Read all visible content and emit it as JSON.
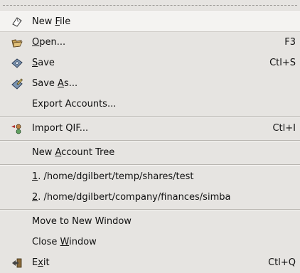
{
  "menu": {
    "items": [
      {
        "pre": "New ",
        "mn": "F",
        "post": "ile",
        "accel": "",
        "icon": "new-file-icon"
      },
      {
        "pre": "",
        "mn": "O",
        "post": "pen...",
        "accel": "F3",
        "icon": "open-folder-icon"
      },
      {
        "pre": "",
        "mn": "S",
        "post": "ave",
        "accel": "Ctl+S",
        "icon": "save-icon"
      },
      {
        "pre": "Save ",
        "mn": "A",
        "post": "s...",
        "accel": "",
        "icon": "save-as-icon"
      },
      {
        "pre": "Export Accounts...",
        "mn": "",
        "post": "",
        "accel": "",
        "icon": ""
      },
      {
        "pre": "Import QIF...",
        "mn": "",
        "post": "",
        "accel": "Ctl+I",
        "icon": "import-icon"
      },
      {
        "pre": "New ",
        "mn": "A",
        "post": "ccount Tree",
        "accel": "",
        "icon": ""
      },
      {
        "pre": "",
        "mn": "1",
        "post": ". /home/dgilbert/temp/shares/test",
        "accel": "",
        "icon": ""
      },
      {
        "pre": "",
        "mn": "2",
        "post": ". /home/dgilbert/company/finances/simba",
        "accel": "",
        "icon": ""
      },
      {
        "pre": "Move to New Window",
        "mn": "",
        "post": "",
        "accel": "",
        "icon": ""
      },
      {
        "pre": "Close ",
        "mn": "W",
        "post": "indow",
        "accel": "",
        "icon": ""
      },
      {
        "pre": "E",
        "mn": "x",
        "post": "it",
        "accel": "Ctl+Q",
        "icon": "exit-icon"
      }
    ]
  }
}
